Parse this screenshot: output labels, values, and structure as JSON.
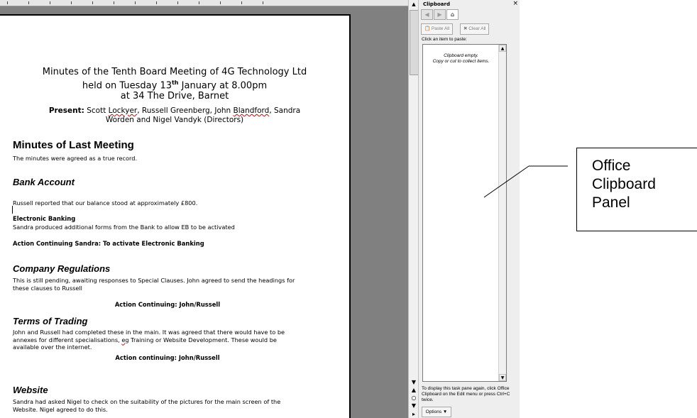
{
  "document": {
    "title_lines": [
      "Minutes of the Tenth Board Meeting of 4G Technology Ltd",
      "held on Tuesday 13th January at 8.00pm",
      "at 34 The Drive, Barnet"
    ],
    "present_label": "Present:",
    "present_text_1a": " Scott ",
    "present_text_1b": "Lockyer",
    "present_text_1c": ", Russell Greenberg, John ",
    "present_text_1d": "Blandford",
    "present_text_1e": ", Sandra",
    "present_text_2": "Worden and Nigel Vandyk (Directors)",
    "sections": {
      "minutes_heading": "Minutes of Last Meeting",
      "minutes_body": "The minutes were agreed as a true record.",
      "bank_heading": "Bank Account",
      "bank_body": "Russell reported that our balance stood at approximately £800.",
      "eb_sub": "Electronic Banking",
      "eb_body": "Sandra produced additional forms from the Bank to allow EB to be activated",
      "eb_action": "Action Continuing Sandra: To activate Electronic Banking",
      "company_heading": "Company Regulations",
      "company_body": "This is still pending, awaiting responses to Special Clauses. John agreed to send the headings for these clauses to Russell",
      "company_action": "Action Continuing: John/Russell",
      "terms_heading": "Terms of Trading",
      "terms_body_a": "John and Russell had completed these in the main. It was agreed that there would have to be annexes for different specialisations, ",
      "terms_body_eg": "eg",
      "terms_body_b": " Training or Website Development. These would be available over the internet.",
      "terms_action": "Action continuing: John/Russell",
      "website_heading": "Website",
      "website_body": "Sandra had asked Nigel to check on the suitability of the pictures for the main screen of the Website. Nigel agreed to do this."
    }
  },
  "task_pane": {
    "title": "Clipboard",
    "close_glyph": "×",
    "paste_all_label": "Paste All",
    "clear_all_label": "Clear All",
    "click_item_label": "Click an item to paste:",
    "empty_line_1": "Clipboard empty.",
    "empty_line_2": "Copy or cut to collect items.",
    "hint": "To display this task pane again, click Office Clipboard on the Edit menu or press Ctrl+C twice.",
    "options_label": "Options ▼"
  },
  "callout": {
    "lines": [
      "Office",
      "Clipboard",
      "Panel"
    ]
  },
  "icons": {
    "back": "back-arrow-icon",
    "forward": "forward-arrow-icon",
    "home": "home-icon",
    "paste_all": "paste-all-icon",
    "clear_all": "clear-all-icon"
  },
  "colors": {
    "workspace_gray": "#808080",
    "pane_bg": "#eeeeee",
    "spell_squiggle": "#d00000"
  }
}
